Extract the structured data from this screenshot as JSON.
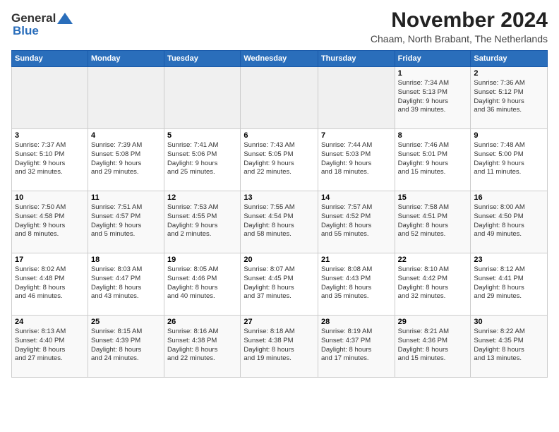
{
  "header": {
    "title": "November 2024",
    "subtitle": "Chaam, North Brabant, The Netherlands"
  },
  "calendar": {
    "headers": [
      "Sunday",
      "Monday",
      "Tuesday",
      "Wednesday",
      "Thursday",
      "Friday",
      "Saturday"
    ],
    "weeks": [
      [
        {
          "day": "",
          "info": ""
        },
        {
          "day": "",
          "info": ""
        },
        {
          "day": "",
          "info": ""
        },
        {
          "day": "",
          "info": ""
        },
        {
          "day": "",
          "info": ""
        },
        {
          "day": "1",
          "info": "Sunrise: 7:34 AM\nSunset: 5:13 PM\nDaylight: 9 hours\nand 39 minutes."
        },
        {
          "day": "2",
          "info": "Sunrise: 7:36 AM\nSunset: 5:12 PM\nDaylight: 9 hours\nand 36 minutes."
        }
      ],
      [
        {
          "day": "3",
          "info": "Sunrise: 7:37 AM\nSunset: 5:10 PM\nDaylight: 9 hours\nand 32 minutes."
        },
        {
          "day": "4",
          "info": "Sunrise: 7:39 AM\nSunset: 5:08 PM\nDaylight: 9 hours\nand 29 minutes."
        },
        {
          "day": "5",
          "info": "Sunrise: 7:41 AM\nSunset: 5:06 PM\nDaylight: 9 hours\nand 25 minutes."
        },
        {
          "day": "6",
          "info": "Sunrise: 7:43 AM\nSunset: 5:05 PM\nDaylight: 9 hours\nand 22 minutes."
        },
        {
          "day": "7",
          "info": "Sunrise: 7:44 AM\nSunset: 5:03 PM\nDaylight: 9 hours\nand 18 minutes."
        },
        {
          "day": "8",
          "info": "Sunrise: 7:46 AM\nSunset: 5:01 PM\nDaylight: 9 hours\nand 15 minutes."
        },
        {
          "day": "9",
          "info": "Sunrise: 7:48 AM\nSunset: 5:00 PM\nDaylight: 9 hours\nand 11 minutes."
        }
      ],
      [
        {
          "day": "10",
          "info": "Sunrise: 7:50 AM\nSunset: 4:58 PM\nDaylight: 9 hours\nand 8 minutes."
        },
        {
          "day": "11",
          "info": "Sunrise: 7:51 AM\nSunset: 4:57 PM\nDaylight: 9 hours\nand 5 minutes."
        },
        {
          "day": "12",
          "info": "Sunrise: 7:53 AM\nSunset: 4:55 PM\nDaylight: 9 hours\nand 2 minutes."
        },
        {
          "day": "13",
          "info": "Sunrise: 7:55 AM\nSunset: 4:54 PM\nDaylight: 8 hours\nand 58 minutes."
        },
        {
          "day": "14",
          "info": "Sunrise: 7:57 AM\nSunset: 4:52 PM\nDaylight: 8 hours\nand 55 minutes."
        },
        {
          "day": "15",
          "info": "Sunrise: 7:58 AM\nSunset: 4:51 PM\nDaylight: 8 hours\nand 52 minutes."
        },
        {
          "day": "16",
          "info": "Sunrise: 8:00 AM\nSunset: 4:50 PM\nDaylight: 8 hours\nand 49 minutes."
        }
      ],
      [
        {
          "day": "17",
          "info": "Sunrise: 8:02 AM\nSunset: 4:48 PM\nDaylight: 8 hours\nand 46 minutes."
        },
        {
          "day": "18",
          "info": "Sunrise: 8:03 AM\nSunset: 4:47 PM\nDaylight: 8 hours\nand 43 minutes."
        },
        {
          "day": "19",
          "info": "Sunrise: 8:05 AM\nSunset: 4:46 PM\nDaylight: 8 hours\nand 40 minutes."
        },
        {
          "day": "20",
          "info": "Sunrise: 8:07 AM\nSunset: 4:45 PM\nDaylight: 8 hours\nand 37 minutes."
        },
        {
          "day": "21",
          "info": "Sunrise: 8:08 AM\nSunset: 4:43 PM\nDaylight: 8 hours\nand 35 minutes."
        },
        {
          "day": "22",
          "info": "Sunrise: 8:10 AM\nSunset: 4:42 PM\nDaylight: 8 hours\nand 32 minutes."
        },
        {
          "day": "23",
          "info": "Sunrise: 8:12 AM\nSunset: 4:41 PM\nDaylight: 8 hours\nand 29 minutes."
        }
      ],
      [
        {
          "day": "24",
          "info": "Sunrise: 8:13 AM\nSunset: 4:40 PM\nDaylight: 8 hours\nand 27 minutes."
        },
        {
          "day": "25",
          "info": "Sunrise: 8:15 AM\nSunset: 4:39 PM\nDaylight: 8 hours\nand 24 minutes."
        },
        {
          "day": "26",
          "info": "Sunrise: 8:16 AM\nSunset: 4:38 PM\nDaylight: 8 hours\nand 22 minutes."
        },
        {
          "day": "27",
          "info": "Sunrise: 8:18 AM\nSunset: 4:38 PM\nDaylight: 8 hours\nand 19 minutes."
        },
        {
          "day": "28",
          "info": "Sunrise: 8:19 AM\nSunset: 4:37 PM\nDaylight: 8 hours\nand 17 minutes."
        },
        {
          "day": "29",
          "info": "Sunrise: 8:21 AM\nSunset: 4:36 PM\nDaylight: 8 hours\nand 15 minutes."
        },
        {
          "day": "30",
          "info": "Sunrise: 8:22 AM\nSunset: 4:35 PM\nDaylight: 8 hours\nand 13 minutes."
        }
      ]
    ]
  }
}
